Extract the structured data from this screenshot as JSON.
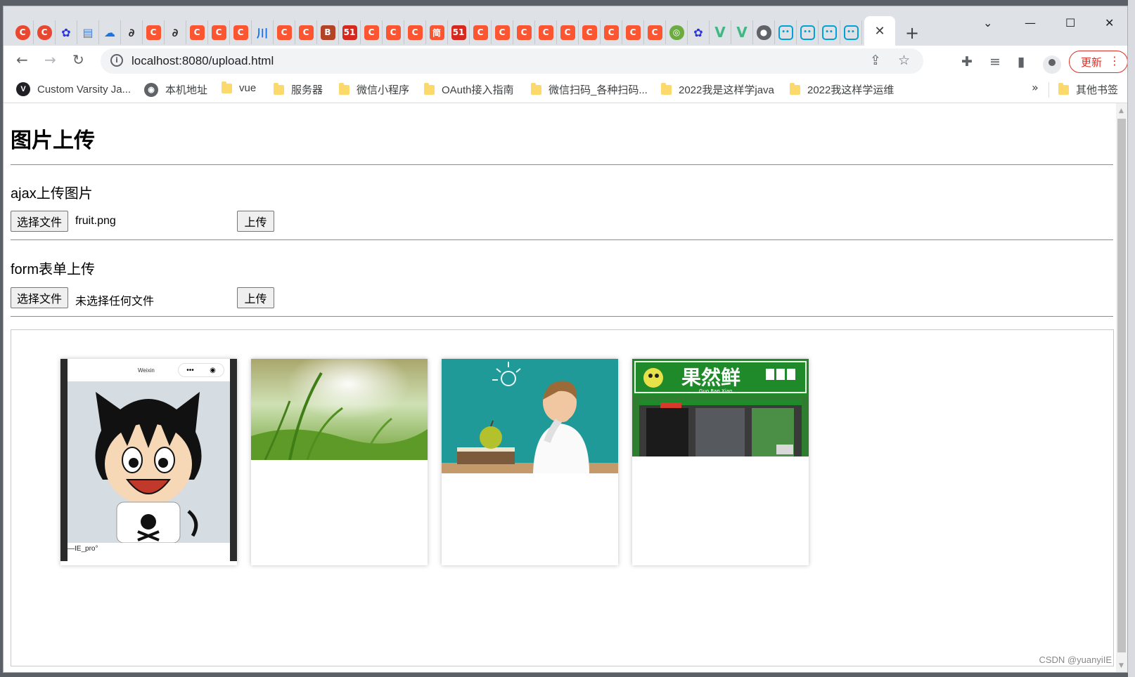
{
  "browser": {
    "tabs": [
      {
        "icon": "csdn-icon",
        "glyph": "C",
        "kind": "cc"
      },
      {
        "icon": "csdn-icon",
        "glyph": "C",
        "kind": "cc"
      },
      {
        "icon": "baidu-paw-icon",
        "glyph": "✿",
        "kind": "paw"
      },
      {
        "icon": "document-icon",
        "glyph": "▤",
        "kind": "doc"
      },
      {
        "icon": "cloud-icon",
        "glyph": "☁",
        "kind": "cloud"
      },
      {
        "icon": "jump-icon",
        "glyph": "∂",
        "kind": "dark"
      },
      {
        "icon": "csdn-icon",
        "glyph": "C",
        "kind": "c"
      },
      {
        "icon": "jump-icon",
        "glyph": "∂",
        "kind": "dark"
      },
      {
        "icon": "csdn-icon",
        "glyph": "C",
        "kind": "c"
      },
      {
        "icon": "csdn-icon",
        "glyph": "C",
        "kind": "c"
      },
      {
        "icon": "csdn-icon",
        "glyph": "C",
        "kind": "c"
      },
      {
        "icon": "river-icon",
        "glyph": "川",
        "kind": "cloud"
      },
      {
        "icon": "csdn-icon",
        "glyph": "C",
        "kind": "c"
      },
      {
        "icon": "csdn-icon",
        "glyph": "C",
        "kind": "c"
      },
      {
        "icon": "b3-icon",
        "glyph": "B",
        "kind": "fire"
      },
      {
        "icon": "51cto-icon",
        "glyph": "51",
        "kind": "red51"
      },
      {
        "icon": "csdn-icon",
        "glyph": "C",
        "kind": "c"
      },
      {
        "icon": "csdn-icon",
        "glyph": "C",
        "kind": "c"
      },
      {
        "icon": "csdn-icon",
        "glyph": "C",
        "kind": "c"
      },
      {
        "icon": "jianshu-icon",
        "glyph": "简",
        "kind": "c"
      },
      {
        "icon": "51cto-icon",
        "glyph": "51",
        "kind": "red51"
      },
      {
        "icon": "csdn-icon",
        "glyph": "C",
        "kind": "c"
      },
      {
        "icon": "csdn-icon",
        "glyph": "C",
        "kind": "c"
      },
      {
        "icon": "csdn-icon",
        "glyph": "C",
        "kind": "c"
      },
      {
        "icon": "csdn-icon",
        "glyph": "C",
        "kind": "c"
      },
      {
        "icon": "csdn-icon",
        "glyph": "C",
        "kind": "c"
      },
      {
        "icon": "csdn-icon",
        "glyph": "C",
        "kind": "c"
      },
      {
        "icon": "csdn-icon",
        "glyph": "C",
        "kind": "c"
      },
      {
        "icon": "csdn-icon",
        "glyph": "C",
        "kind": "c"
      },
      {
        "icon": "csdn-icon",
        "glyph": "C",
        "kind": "c"
      },
      {
        "icon": "target-icon",
        "glyph": "◎",
        "kind": "green"
      },
      {
        "icon": "baidu-paw-icon",
        "glyph": "✿",
        "kind": "paw"
      },
      {
        "icon": "vue-icon",
        "glyph": "V",
        "kind": "vue"
      },
      {
        "icon": "vue-icon",
        "glyph": "V",
        "kind": "vue"
      },
      {
        "icon": "globe-icon",
        "glyph": "●",
        "kind": "globe"
      },
      {
        "icon": "bilibili-icon",
        "glyph": "••",
        "kind": "bili"
      },
      {
        "icon": "bilibili-icon",
        "glyph": "••",
        "kind": "bili"
      },
      {
        "icon": "bilibili-icon",
        "glyph": "••",
        "kind": "bili"
      },
      {
        "icon": "bilibili-icon",
        "glyph": "••",
        "kind": "bili"
      }
    ],
    "url": "localhost:8080/upload.html",
    "update_label": "更新",
    "bookmarks": [
      {
        "label": "Custom Varsity Ja...",
        "type": "circle",
        "glyph": "V"
      },
      {
        "label": "本机地址",
        "type": "globe",
        "glyph": "◉"
      },
      {
        "label": "vue",
        "type": "folder"
      },
      {
        "label": "服务器",
        "type": "folder"
      },
      {
        "label": "微信小程序",
        "type": "folder"
      },
      {
        "label": "OAuth接入指南",
        "type": "folder"
      },
      {
        "label": "微信扫码_各种扫码...",
        "type": "folder"
      },
      {
        "label": "2022我是这样学java",
        "type": "folder"
      },
      {
        "label": "2022我这样学运维",
        "type": "folder"
      }
    ],
    "bookmarks_more": "»",
    "other_bookmarks": "其他书签"
  },
  "page": {
    "title": "图片上传",
    "ajax_section": {
      "heading": "ajax上传图片",
      "choose_label": "选择文件",
      "file_name": "fruit.png",
      "upload_label": "上传"
    },
    "form_section": {
      "heading": "form表单上传",
      "choose_label": "选择文件",
      "file_name": "未选择任何文件",
      "upload_label": "上传"
    },
    "gallery": [
      {
        "kind": "phone-screenshot",
        "top_label": "Weixin",
        "caption": "—IE_pro°"
      },
      {
        "kind": "grass-photo"
      },
      {
        "kind": "boy-with-apple-photo"
      },
      {
        "kind": "fruit-shop-photo",
        "sign_text": "果然鲜",
        "sign_sub": "Guo Ran Xian"
      }
    ]
  },
  "watermark": "CSDN @yuanyiIE",
  "colors": {
    "csdn_red": "#fc5531",
    "update_red": "#d93025",
    "vue_green": "#41b883",
    "bili_blue": "#00a1d6"
  }
}
